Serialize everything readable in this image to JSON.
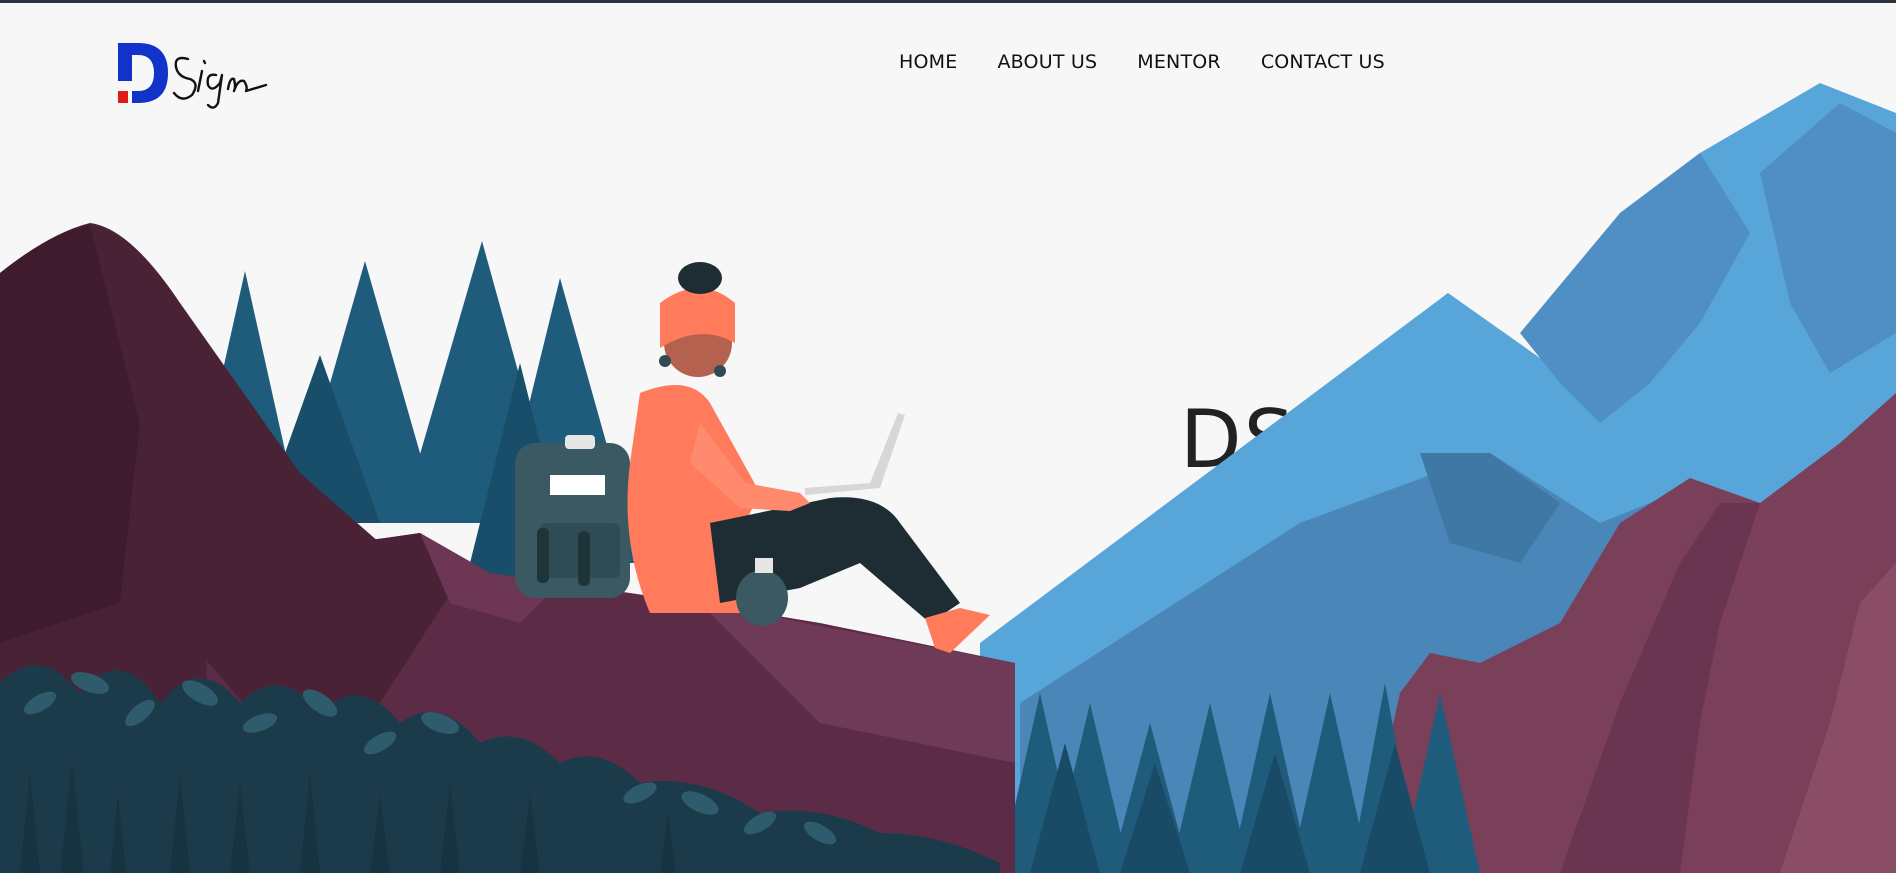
{
  "brand": {
    "mark": "D",
    "script": "Sign"
  },
  "nav": {
    "items": [
      {
        "label": "HOME"
      },
      {
        "label": "ABOUT US"
      },
      {
        "label": "MENTOR"
      },
      {
        "label": "CONTACT US"
      }
    ]
  },
  "hero": {
    "title": "DSIGN ACADEMY"
  },
  "colors": {
    "logo_blue": "#1233c9",
    "logo_red": "#e01b1b",
    "sky_mountain": "#58a5d9",
    "mountain_dark": "#4a2236",
    "mountain_rose": "#7a4059",
    "forest": "#1f5b7a",
    "character_jacket": "#ff7b5c"
  }
}
